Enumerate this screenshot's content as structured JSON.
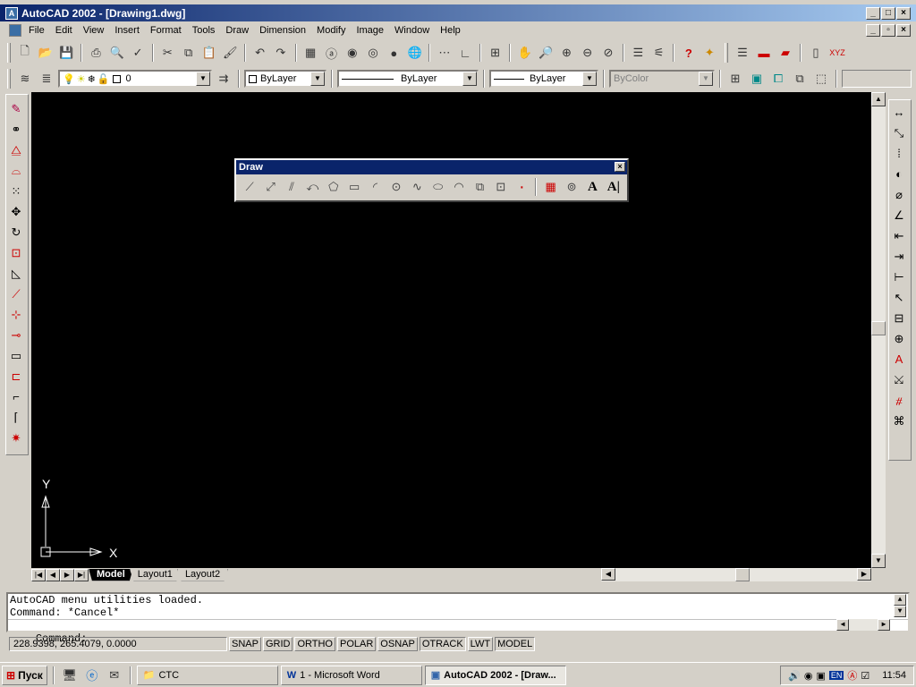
{
  "window": {
    "title": "AutoCAD 2002 - [Drawing1.dwg]",
    "app_icon": "autocad-icon",
    "controls": [
      "_",
      "□",
      "×"
    ]
  },
  "menu": {
    "items": [
      "File",
      "Edit",
      "View",
      "Insert",
      "Format",
      "Tools",
      "Draw",
      "Dimension",
      "Modify",
      "Image",
      "Window",
      "Help"
    ]
  },
  "properties_bar": {
    "layer_value": "0",
    "color_value": "ByLayer",
    "linetype_value": "ByLayer",
    "lineweight_value": "ByLayer",
    "plotstyle_value": "ByColor"
  },
  "draw_toolbar": {
    "title": "Draw",
    "close": "×",
    "tools": [
      {
        "name": "line-icon",
        "glyph": "⟋"
      },
      {
        "name": "construction-line-icon",
        "glyph": "⤢"
      },
      {
        "name": "multiline-icon",
        "glyph": "⫽"
      },
      {
        "name": "polyline-icon",
        "glyph": "⤺"
      },
      {
        "name": "polygon-icon",
        "glyph": "⬠"
      },
      {
        "name": "rectangle-icon",
        "glyph": "▭"
      },
      {
        "name": "arc-icon",
        "glyph": "◜"
      },
      {
        "name": "circle-icon",
        "glyph": "⊙"
      },
      {
        "name": "spline-icon",
        "glyph": "∿"
      },
      {
        "name": "ellipse-icon",
        "glyph": "⬭"
      },
      {
        "name": "ellipse-arc-icon",
        "glyph": "◠"
      },
      {
        "name": "insert-block-icon",
        "glyph": "⧉"
      },
      {
        "name": "make-block-icon",
        "glyph": "⊡"
      },
      {
        "name": "point-icon",
        "glyph": "·"
      },
      {
        "name": "hatch-icon",
        "glyph": "▦"
      },
      {
        "name": "region-icon",
        "glyph": "⊚"
      },
      {
        "name": "multiline-text-icon",
        "glyph": "A"
      },
      {
        "name": "single-line-text-icon",
        "glyph": "A|"
      }
    ]
  },
  "ucs": {
    "y": "Y",
    "x": "X"
  },
  "tabs": [
    "Model",
    "Layout1",
    "Layout2"
  ],
  "command": {
    "lines": [
      "AutoCAD menu utilities loaded.",
      "Command: *Cancel*"
    ],
    "prompt": "Command:"
  },
  "status": {
    "coords": "228.9398, 265.4079, 0.0000",
    "buttons": [
      "SNAP",
      "GRID",
      "ORTHO",
      "POLAR",
      "OSNAP",
      "OTRACK",
      "LWT",
      "MODEL"
    ]
  },
  "taskbar": {
    "start": "Пуск",
    "tasks": [
      "CTC",
      "1 - Microsoft Word",
      "AutoCAD 2002 - [Draw..."
    ],
    "clock": "11:54",
    "lang": "EN"
  },
  "colors": {
    "canvas": "#000000",
    "title_active": "#0a246a",
    "face": "#d4d0c8"
  }
}
